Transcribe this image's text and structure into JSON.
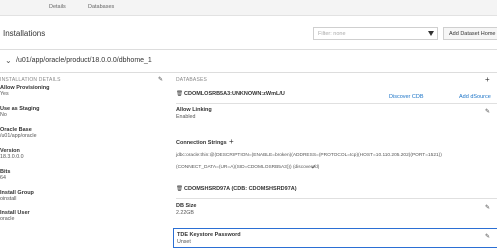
{
  "tabs": {
    "details": "Details",
    "databases": "Databases"
  },
  "header": {
    "title": "Installations",
    "filter_placeholder": "Filter: none",
    "add_button": "Add Dataset Home"
  },
  "home": {
    "path": "/u01/app/oracle/product/18.0.0.0/dbhome_1"
  },
  "installation_details": {
    "section_title": "INSTALLATION DETAILS",
    "fields": [
      {
        "label": "Allow Provisioning",
        "value": "Yes"
      },
      {
        "label": "Use as Staging",
        "value": "No"
      },
      {
        "label": "Oracle Base",
        "value": "/u01/app/oracle"
      },
      {
        "label": "Version",
        "value": "18.3.0.0.0"
      },
      {
        "label": "Bits",
        "value": "64"
      },
      {
        "label": "Install Group",
        "value": "oinstall"
      },
      {
        "label": "Install User",
        "value": "oracle"
      }
    ]
  },
  "databases": {
    "section_title": "DATABASES",
    "db1": {
      "name": "CDOMLOSRB5A3:UNKNOWN:zWmL/U",
      "discover_cdb": "Discover CDB",
      "add_dsource": "Add dSource",
      "allow_linking_label": "Allow Linking",
      "allow_linking_value": "Enabled",
      "connection_strings_title": "Connection Strings",
      "conn_line1": "jdbc:oracle:thin:@(DESCRIPTION=(ENABLE=broken)(ADDRESS=(PROTOCOL=tcp)(HOST=10.110.205.202)(PORT=1521))",
      "conn_line2": "(CONNECT_DATA=(UR=A)(SID=CDOMLOSRB5A3))) (discovered)"
    },
    "db2": {
      "name": "CDOMSHSRD97A (CDB: CDOMSHSRD97A)",
      "db_size_label": "DB Size",
      "db_size_value": "2.22GB",
      "tde_label": "TDE Keystore Password",
      "tde_value": "Unset"
    }
  }
}
